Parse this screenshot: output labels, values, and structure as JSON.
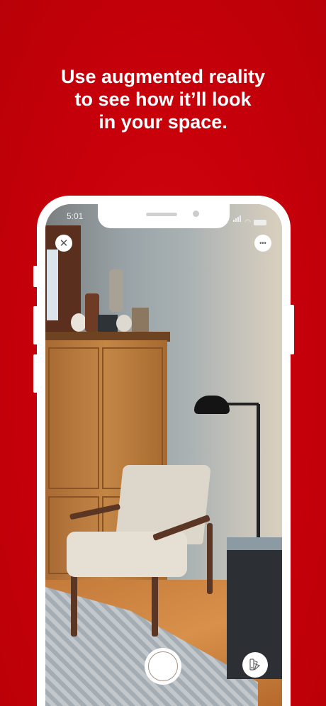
{
  "headline": {
    "lines": [
      "Use augmented reality",
      "to see how it’ll look",
      "in your space."
    ]
  },
  "status_bar": {
    "time": "5:01"
  },
  "ar_view": {
    "close_icon": "close-icon",
    "more_icon": "more-icon",
    "shutter_icon": "shutter-icon",
    "swatch_icon": "color-swatch-icon",
    "more_glyph": "•••",
    "close_glyph": "✕"
  },
  "colors": {
    "brand": "#cc0000"
  }
}
